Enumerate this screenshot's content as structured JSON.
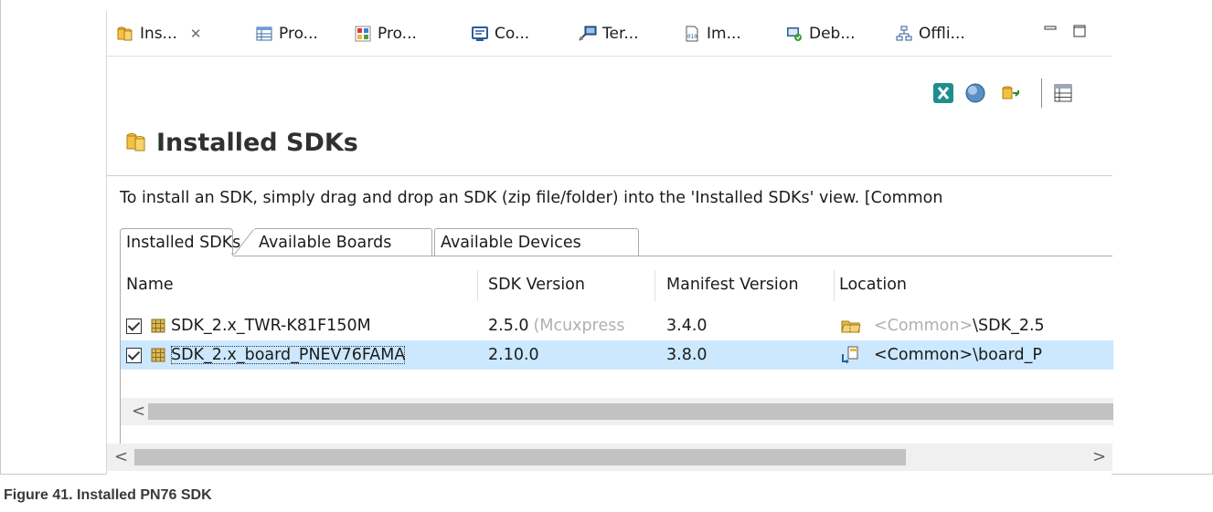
{
  "view_tabs": [
    {
      "label": "Ins...",
      "icon": "sdk-cylinder-icon",
      "active": true
    },
    {
      "label": "Pro...",
      "icon": "table-icon"
    },
    {
      "label": "Pro...",
      "icon": "profile-icon"
    },
    {
      "label": "Co...",
      "icon": "console-icon"
    },
    {
      "label": "Ter...",
      "icon": "terminal-icon"
    },
    {
      "label": "Im...",
      "icon": "binary-image-icon"
    },
    {
      "label": "Deb...",
      "icon": "debug-icon"
    },
    {
      "label": "Offli...",
      "icon": "offline-tree-icon"
    }
  ],
  "window_controls": {
    "minimize": "minimize-icon",
    "maximize": "maximize-icon"
  },
  "toolbar_icons": [
    "excel-export-icon",
    "globe-icon",
    "import-sdk-icon",
    "view-columns-icon"
  ],
  "header": {
    "title": "Installed SDKs"
  },
  "hint": "To install an SDK, simply drag and drop an SDK (zip file/folder) into the 'Installed SDKs' view. [Common",
  "inner_tabs": [
    "Installed SDKs",
    "Available Boards",
    "Available Devices"
  ],
  "columns": [
    "Name",
    "SDK Version",
    "Manifest Version",
    "Location"
  ],
  "rows": [
    {
      "checked": true,
      "name": "SDK_2.x_TWR-K81F150M",
      "sdk_version": "2.5.0",
      "sdk_version_note": "(Mcuxpress",
      "manifest_version": "3.4.0",
      "location_prefix": "<Common>",
      "location_rest": "\\SDK_2.5",
      "location_icon": "folder-zip-icon",
      "selected": false
    },
    {
      "checked": true,
      "name": "SDK_2.x_board_PNEV76FAMA",
      "sdk_version": "2.10.0",
      "sdk_version_note": "",
      "manifest_version": "3.8.0",
      "location_prefix": "<Common>",
      "location_rest": "\\board_P",
      "location_icon": "folder-link-icon",
      "selected": true
    }
  ],
  "scroll": {
    "left_arrow": "<",
    "right_arrow": ">"
  },
  "caption": "Figure 41.  Installed PN76 SDK",
  "colors": {
    "selection": "#cce8ff",
    "scrollbar_thumb": "#c2c2c2",
    "caption": "#3a3a3a"
  }
}
